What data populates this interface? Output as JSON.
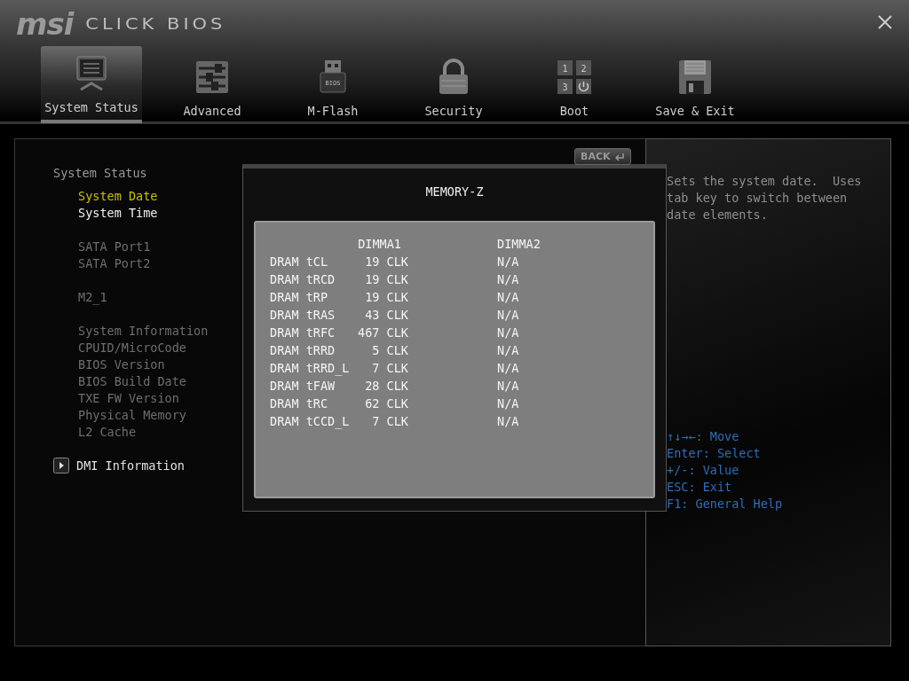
{
  "header": {
    "logo": "msi",
    "title": "CLICK BIOS"
  },
  "tabs": [
    {
      "label": "System Status",
      "selected": true,
      "kind": "monitor"
    },
    {
      "label": "Advanced",
      "selected": false,
      "kind": "sliders"
    },
    {
      "label": "M-Flash",
      "selected": false,
      "kind": "flash",
      "icon_text": "BIOS"
    },
    {
      "label": "Security",
      "selected": false,
      "kind": "lock"
    },
    {
      "label": "Boot",
      "selected": false,
      "kind": "boot",
      "icon_text": [
        "1",
        "2",
        "3"
      ]
    },
    {
      "label": "Save & Exit",
      "selected": false,
      "kind": "disk"
    }
  ],
  "back_button": {
    "label": "BACK"
  },
  "menu": {
    "heading": "System Status",
    "groups": [
      [
        {
          "label": "System Date",
          "selected": true,
          "disabled": false
        },
        {
          "label": "System Time",
          "selected": false,
          "disabled": false
        }
      ],
      [
        {
          "label": "SATA Port1",
          "selected": false,
          "disabled": true
        },
        {
          "label": "SATA Port2",
          "selected": false,
          "disabled": true
        }
      ],
      [
        {
          "label": "M2_1",
          "selected": false,
          "disabled": true
        }
      ],
      [
        {
          "label": "System Information",
          "selected": false,
          "disabled": true
        },
        {
          "label": "CPUID/MicroCode",
          "selected": false,
          "disabled": true
        },
        {
          "label": "BIOS Version",
          "selected": false,
          "disabled": true
        },
        {
          "label": "BIOS Build Date",
          "selected": false,
          "disabled": true
        },
        {
          "label": "TXE FW Version",
          "selected": false,
          "disabled": true
        },
        {
          "label": "Physical Memory",
          "selected": false,
          "disabled": true
        },
        {
          "label": "L2 Cache",
          "selected": false,
          "disabled": true
        }
      ]
    ],
    "submenu": {
      "label": "DMI Information"
    }
  },
  "dialog": {
    "title": "MEMORY-Z",
    "columns": [
      "DIMMA1",
      "DIMMA2"
    ],
    "rows": [
      {
        "label": "DRAM tCL",
        "dimma1": "19 CLK",
        "dimma2": "N/A"
      },
      {
        "label": "DRAM tRCD",
        "dimma1": "19 CLK",
        "dimma2": "N/A"
      },
      {
        "label": "DRAM tRP",
        "dimma1": "19 CLK",
        "dimma2": "N/A"
      },
      {
        "label": "DRAM tRAS",
        "dimma1": "43 CLK",
        "dimma2": "N/A"
      },
      {
        "label": "DRAM tRFC",
        "dimma1": "467 CLK",
        "dimma2": "N/A"
      },
      {
        "label": "DRAM tRRD",
        "dimma1": "5 CLK",
        "dimma2": "N/A"
      },
      {
        "label": "DRAM tRRD_L",
        "dimma1": "7 CLK",
        "dimma2": "N/A"
      },
      {
        "label": "DRAM tFAW",
        "dimma1": "28 CLK",
        "dimma2": "N/A"
      },
      {
        "label": "DRAM tRC",
        "dimma1": "62 CLK",
        "dimma2": "N/A"
      },
      {
        "label": "DRAM tCCD_L",
        "dimma1": "7 CLK",
        "dimma2": "N/A"
      }
    ]
  },
  "help": {
    "description": "Sets the system date.  Uses tab key to switch between date elements.",
    "keys": [
      "↑↓→←: Move",
      "Enter: Select",
      "+/-: Value",
      "ESC: Exit",
      "F1: General Help"
    ]
  }
}
